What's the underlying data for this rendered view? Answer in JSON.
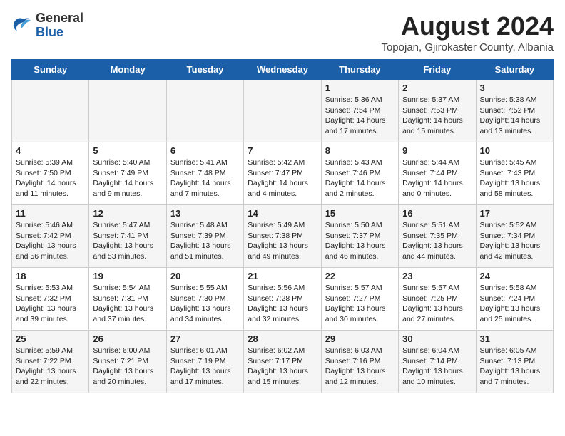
{
  "header": {
    "logo_general": "General",
    "logo_blue": "Blue",
    "title": "August 2024",
    "subtitle": "Topojan, Gjirokaster County, Albania"
  },
  "days_of_week": [
    "Sunday",
    "Monday",
    "Tuesday",
    "Wednesday",
    "Thursday",
    "Friday",
    "Saturday"
  ],
  "weeks": [
    [
      {
        "day": "",
        "info": ""
      },
      {
        "day": "",
        "info": ""
      },
      {
        "day": "",
        "info": ""
      },
      {
        "day": "",
        "info": ""
      },
      {
        "day": "1",
        "info": "Sunrise: 5:36 AM\nSunset: 7:54 PM\nDaylight: 14 hours\nand 17 minutes."
      },
      {
        "day": "2",
        "info": "Sunrise: 5:37 AM\nSunset: 7:53 PM\nDaylight: 14 hours\nand 15 minutes."
      },
      {
        "day": "3",
        "info": "Sunrise: 5:38 AM\nSunset: 7:52 PM\nDaylight: 14 hours\nand 13 minutes."
      }
    ],
    [
      {
        "day": "4",
        "info": "Sunrise: 5:39 AM\nSunset: 7:50 PM\nDaylight: 14 hours\nand 11 minutes."
      },
      {
        "day": "5",
        "info": "Sunrise: 5:40 AM\nSunset: 7:49 PM\nDaylight: 14 hours\nand 9 minutes."
      },
      {
        "day": "6",
        "info": "Sunrise: 5:41 AM\nSunset: 7:48 PM\nDaylight: 14 hours\nand 7 minutes."
      },
      {
        "day": "7",
        "info": "Sunrise: 5:42 AM\nSunset: 7:47 PM\nDaylight: 14 hours\nand 4 minutes."
      },
      {
        "day": "8",
        "info": "Sunrise: 5:43 AM\nSunset: 7:46 PM\nDaylight: 14 hours\nand 2 minutes."
      },
      {
        "day": "9",
        "info": "Sunrise: 5:44 AM\nSunset: 7:44 PM\nDaylight: 14 hours\nand 0 minutes."
      },
      {
        "day": "10",
        "info": "Sunrise: 5:45 AM\nSunset: 7:43 PM\nDaylight: 13 hours\nand 58 minutes."
      }
    ],
    [
      {
        "day": "11",
        "info": "Sunrise: 5:46 AM\nSunset: 7:42 PM\nDaylight: 13 hours\nand 56 minutes."
      },
      {
        "day": "12",
        "info": "Sunrise: 5:47 AM\nSunset: 7:41 PM\nDaylight: 13 hours\nand 53 minutes."
      },
      {
        "day": "13",
        "info": "Sunrise: 5:48 AM\nSunset: 7:39 PM\nDaylight: 13 hours\nand 51 minutes."
      },
      {
        "day": "14",
        "info": "Sunrise: 5:49 AM\nSunset: 7:38 PM\nDaylight: 13 hours\nand 49 minutes."
      },
      {
        "day": "15",
        "info": "Sunrise: 5:50 AM\nSunset: 7:37 PM\nDaylight: 13 hours\nand 46 minutes."
      },
      {
        "day": "16",
        "info": "Sunrise: 5:51 AM\nSunset: 7:35 PM\nDaylight: 13 hours\nand 44 minutes."
      },
      {
        "day": "17",
        "info": "Sunrise: 5:52 AM\nSunset: 7:34 PM\nDaylight: 13 hours\nand 42 minutes."
      }
    ],
    [
      {
        "day": "18",
        "info": "Sunrise: 5:53 AM\nSunset: 7:32 PM\nDaylight: 13 hours\nand 39 minutes."
      },
      {
        "day": "19",
        "info": "Sunrise: 5:54 AM\nSunset: 7:31 PM\nDaylight: 13 hours\nand 37 minutes."
      },
      {
        "day": "20",
        "info": "Sunrise: 5:55 AM\nSunset: 7:30 PM\nDaylight: 13 hours\nand 34 minutes."
      },
      {
        "day": "21",
        "info": "Sunrise: 5:56 AM\nSunset: 7:28 PM\nDaylight: 13 hours\nand 32 minutes."
      },
      {
        "day": "22",
        "info": "Sunrise: 5:57 AM\nSunset: 7:27 PM\nDaylight: 13 hours\nand 30 minutes."
      },
      {
        "day": "23",
        "info": "Sunrise: 5:57 AM\nSunset: 7:25 PM\nDaylight: 13 hours\nand 27 minutes."
      },
      {
        "day": "24",
        "info": "Sunrise: 5:58 AM\nSunset: 7:24 PM\nDaylight: 13 hours\nand 25 minutes."
      }
    ],
    [
      {
        "day": "25",
        "info": "Sunrise: 5:59 AM\nSunset: 7:22 PM\nDaylight: 13 hours\nand 22 minutes."
      },
      {
        "day": "26",
        "info": "Sunrise: 6:00 AM\nSunset: 7:21 PM\nDaylight: 13 hours\nand 20 minutes."
      },
      {
        "day": "27",
        "info": "Sunrise: 6:01 AM\nSunset: 7:19 PM\nDaylight: 13 hours\nand 17 minutes."
      },
      {
        "day": "28",
        "info": "Sunrise: 6:02 AM\nSunset: 7:17 PM\nDaylight: 13 hours\nand 15 minutes."
      },
      {
        "day": "29",
        "info": "Sunrise: 6:03 AM\nSunset: 7:16 PM\nDaylight: 13 hours\nand 12 minutes."
      },
      {
        "day": "30",
        "info": "Sunrise: 6:04 AM\nSunset: 7:14 PM\nDaylight: 13 hours\nand 10 minutes."
      },
      {
        "day": "31",
        "info": "Sunrise: 6:05 AM\nSunset: 7:13 PM\nDaylight: 13 hours\nand 7 minutes."
      }
    ]
  ]
}
